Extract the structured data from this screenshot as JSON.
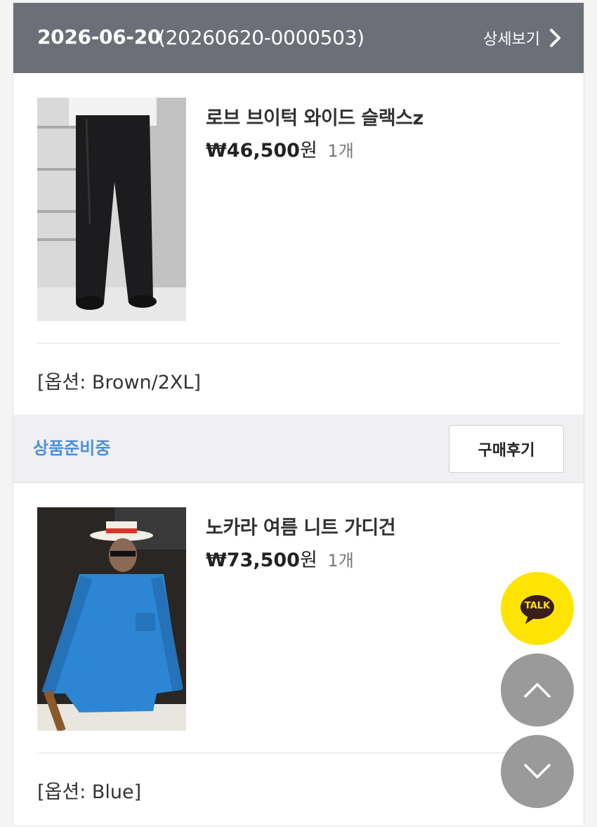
{
  "order": {
    "date": "2026-06-20",
    "order_number": "(20260620-0000503)",
    "detail_label": "상세보기"
  },
  "products": [
    {
      "name": "로브 브이턱 와이드 슬랙스z",
      "price": "₩46,500",
      "currency_suffix": "원",
      "quantity": "1개",
      "option": "[옵션: Brown/2XL]",
      "image_icon": "wide-slacks-photo"
    },
    {
      "name": "노카라 여름 니트 가디건",
      "price": "₩73,500",
      "currency_suffix": "원",
      "quantity": "1개",
      "option": "[옵션: Blue]",
      "image_icon": "knit-cardigan-photo"
    }
  ],
  "status": {
    "label": "상품준비중",
    "review_button": "구매후기",
    "color": "#4a90d9"
  },
  "floating": {
    "talk_label": "TALK",
    "talk_color": "#fde403",
    "scroll_up_icon": "chevron-up-icon",
    "scroll_down_icon": "chevron-down-icon"
  },
  "colors": {
    "header_bg": "#6c6f78"
  }
}
